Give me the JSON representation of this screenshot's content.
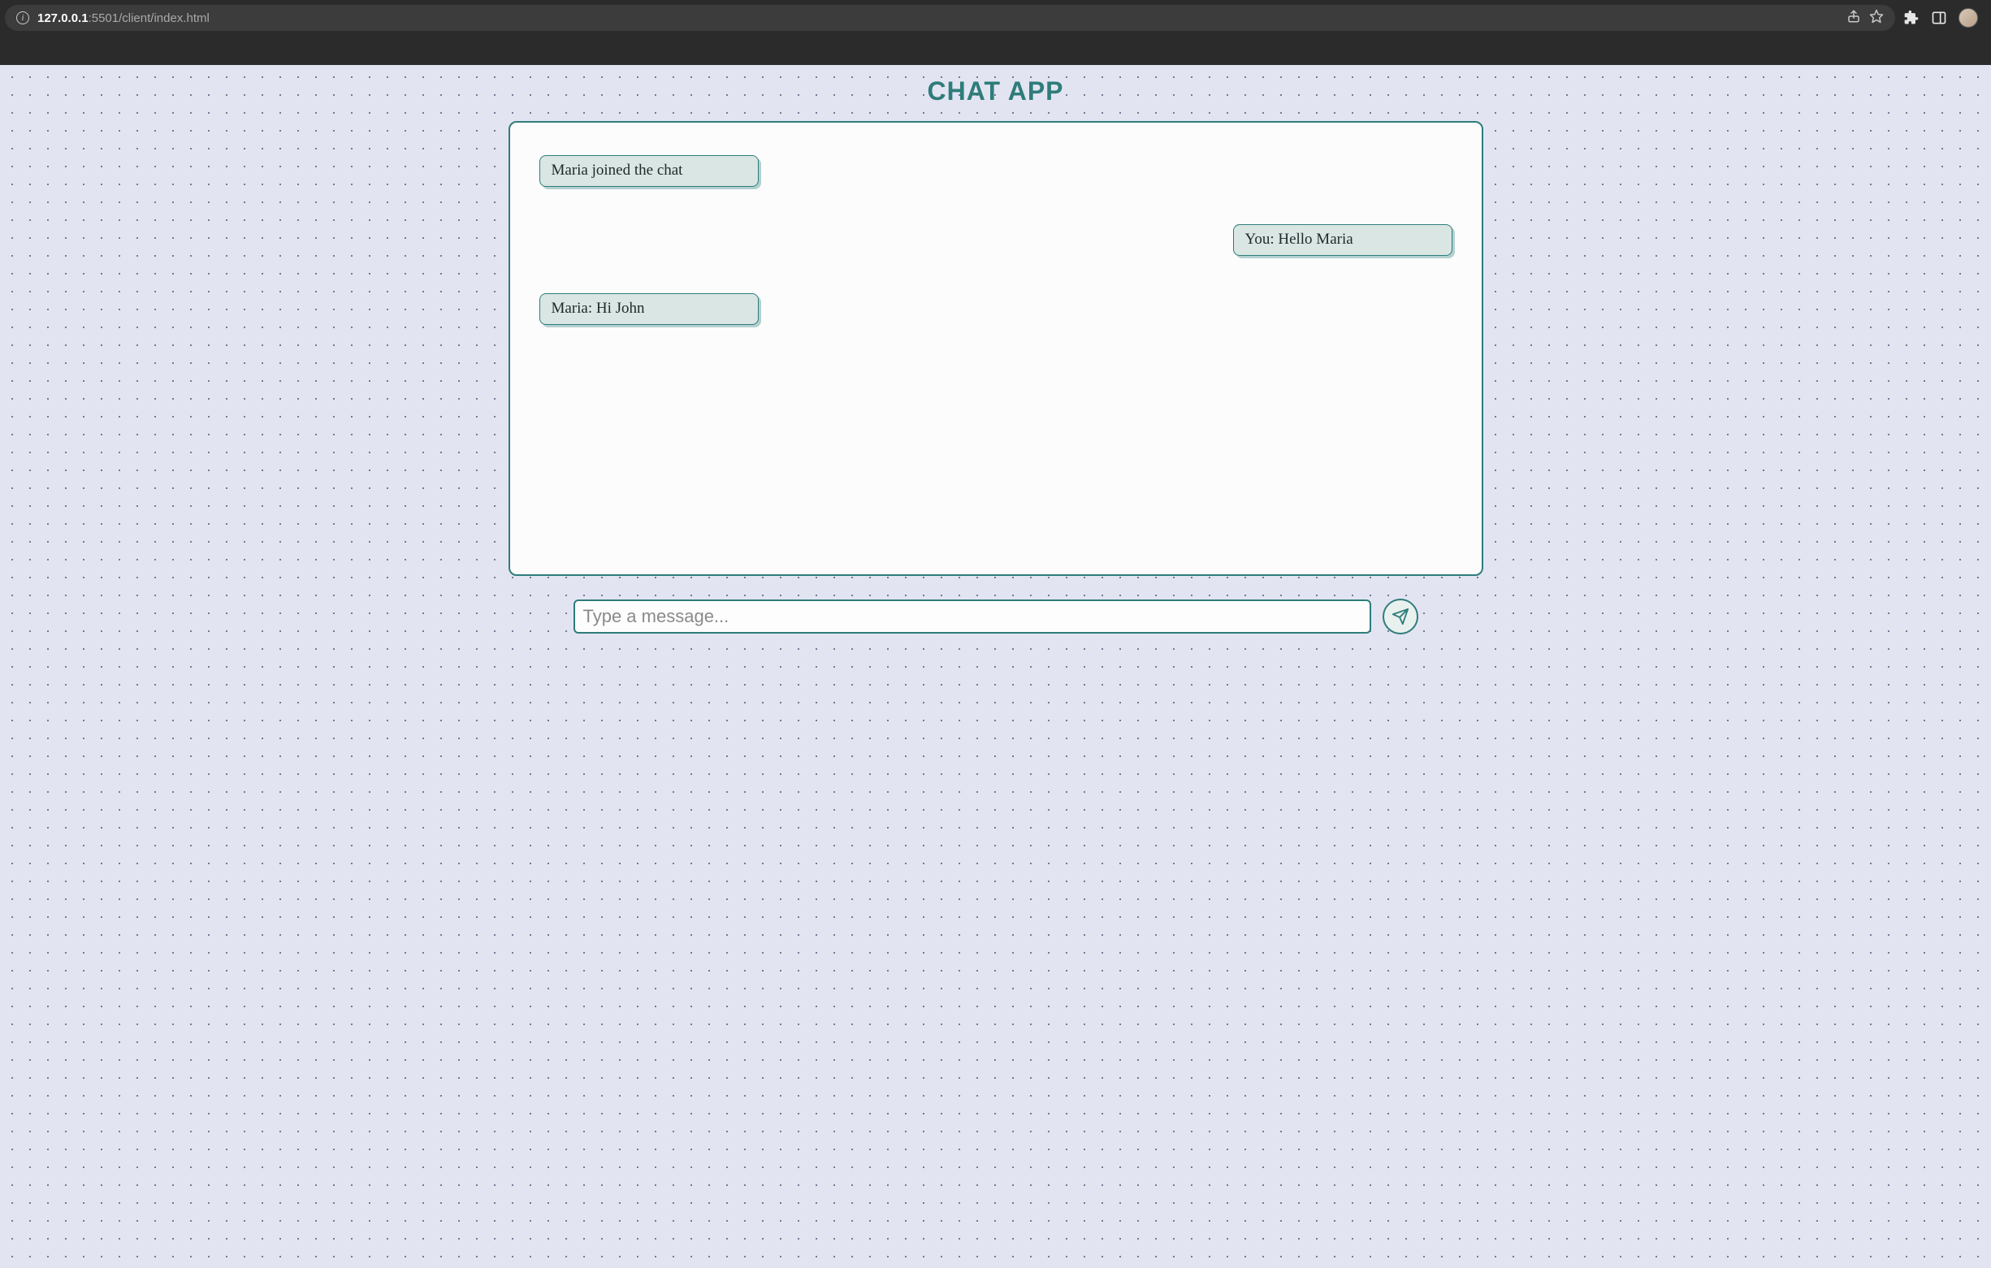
{
  "browser": {
    "url_host": "127.0.0.1",
    "url_rest": ":5501/client/index.html"
  },
  "page": {
    "title": "CHAT APP"
  },
  "chat": {
    "messages": [
      {
        "side": "left",
        "text": "Maria joined the chat"
      },
      {
        "side": "right",
        "text": "You: Hello Maria"
      },
      {
        "side": "left",
        "text": "Maria: Hi John"
      }
    ]
  },
  "composer": {
    "placeholder": "Type a message...",
    "value": ""
  },
  "colors": {
    "accent": "#2e7d7a",
    "bubble": "#d9e6e3",
    "page_bg": "#e3e4f2"
  }
}
